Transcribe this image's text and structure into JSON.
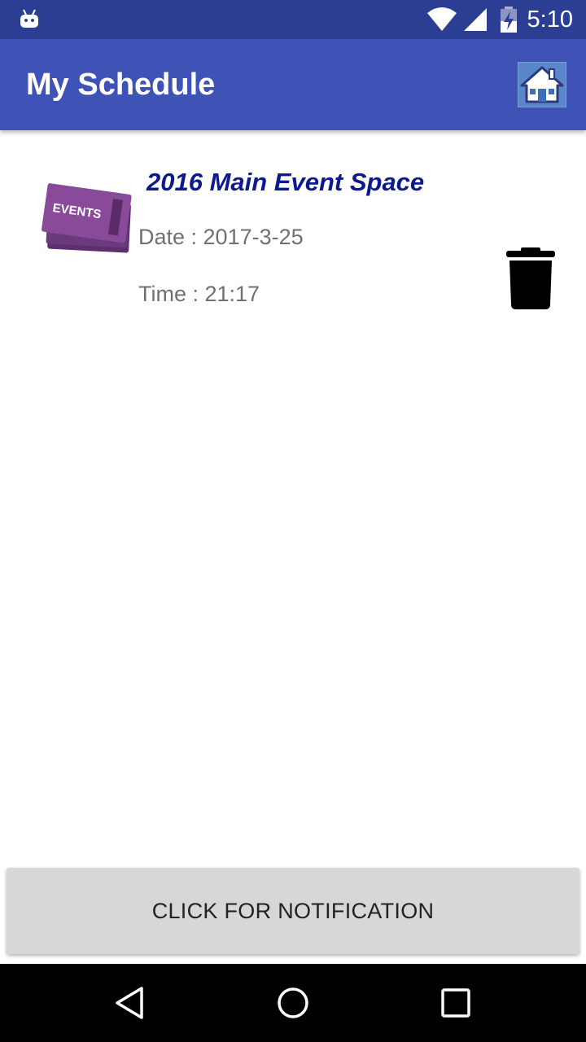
{
  "status_bar": {
    "time": "5:10",
    "icons": [
      "android-icon",
      "wifi-icon",
      "cell-signal-icon",
      "battery-charging-icon"
    ]
  },
  "app_bar": {
    "title": "My Schedule",
    "home_icon": "home-icon"
  },
  "schedule": {
    "items": [
      {
        "thumbnail_icon": "events-ticket-icon",
        "thumbnail_text": "EVENTS",
        "title": "2016 Main Event Space",
        "date": "Date : 2017-3-25",
        "time": "Time : 21:17",
        "delete_icon": "trash-icon"
      }
    ]
  },
  "notify_button": {
    "label": "CLICK FOR NOTIFICATION"
  },
  "nav_bar": {
    "icons": [
      "back-icon",
      "home-circle-icon",
      "recents-icon"
    ]
  },
  "colors": {
    "status_bar": "#2c3e93",
    "app_bar": "#3e53b5",
    "title_text": "#0d1a8e",
    "secondary_text": "#707070",
    "button_bg": "#d6d7d7",
    "ticket_purple": "#7a3f8a"
  }
}
